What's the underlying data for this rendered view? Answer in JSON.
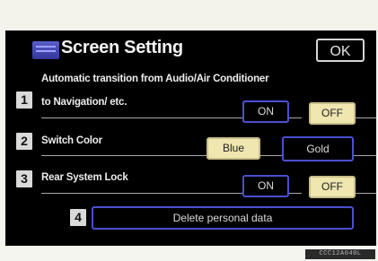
{
  "header": {
    "title": "Screen Setting",
    "ok_label": "OK",
    "icon": "screen-setting-icon"
  },
  "rows": [
    {
      "number": "1",
      "label_line1": "Automatic transition from Audio/Air Conditioner",
      "label_line2": "to Navigation/ etc.",
      "options": [
        "ON",
        "OFF"
      ],
      "selected": "OFF"
    },
    {
      "number": "2",
      "label": "Switch Color",
      "options": [
        "Blue",
        "Gold"
      ],
      "selected": "Blue"
    },
    {
      "number": "3",
      "label": "Rear System Lock",
      "options": [
        "ON",
        "OFF"
      ],
      "selected": "OFF"
    }
  ],
  "delete": {
    "number": "4",
    "label": "Delete personal data"
  },
  "image_code": "CCC12A040L",
  "colors": {
    "screen_bg": "#000000",
    "button_border": "#4a4fd2",
    "selected_fill": "#efe6b0",
    "text": "#ececec"
  }
}
